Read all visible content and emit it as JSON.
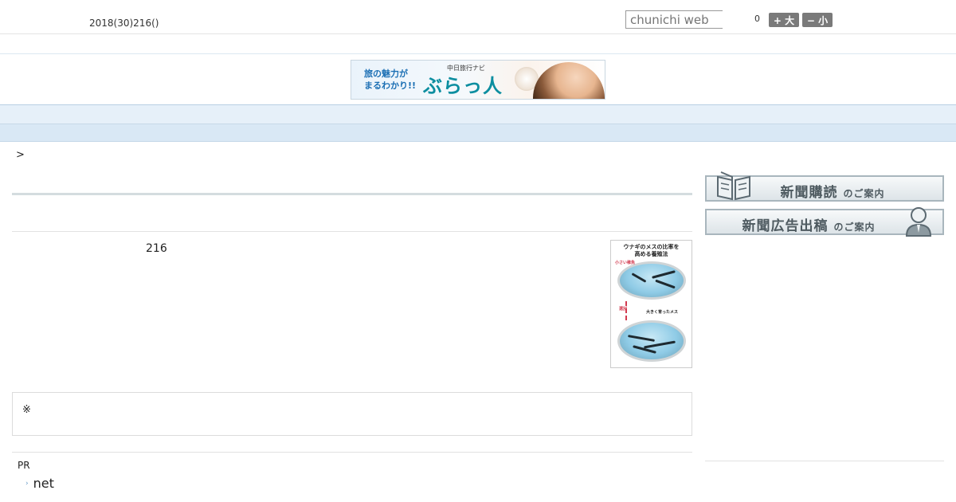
{
  "header": {
    "date": "2018(30)216()",
    "search_placeholder": "chunichi web",
    "zoom_level": "0",
    "font_larger_label": "+ 大",
    "font_smaller_label": "− 小"
  },
  "banner": {
    "lead": [
      "旅の魅力が",
      "まるわかり!!"
    ],
    "sub": "中日旅行ナビ",
    "title": "ぶらっ人"
  },
  "nav": {
    "items": [
      "　　",
      "　　",
      "　　",
      "　　",
      "　　",
      "　　",
      "　　",
      "　　",
      "　　"
    ]
  },
  "breadcrumb": ">",
  "article": {
    "date_text": "216",
    "figure_caption": [
      "ウナギのメスの比率を",
      "高める養殖法"
    ],
    "figure_labels": [
      "小さい稚魚",
      "選別",
      "大きく育ったメス"
    ]
  },
  "note": "※",
  "pr": {
    "label": "PR",
    "link": "net"
  },
  "sidebar": {
    "subscribe_main": "新聞購読",
    "subscribe_suffix": "のご案内",
    "ad_main": "新聞広告出稿",
    "ad_suffix": "のご案内"
  },
  "colors": {
    "nav_bg": "#e6f0f9",
    "font_button": "#7a7a7a",
    "link_arrow": "#6a9cc7"
  }
}
